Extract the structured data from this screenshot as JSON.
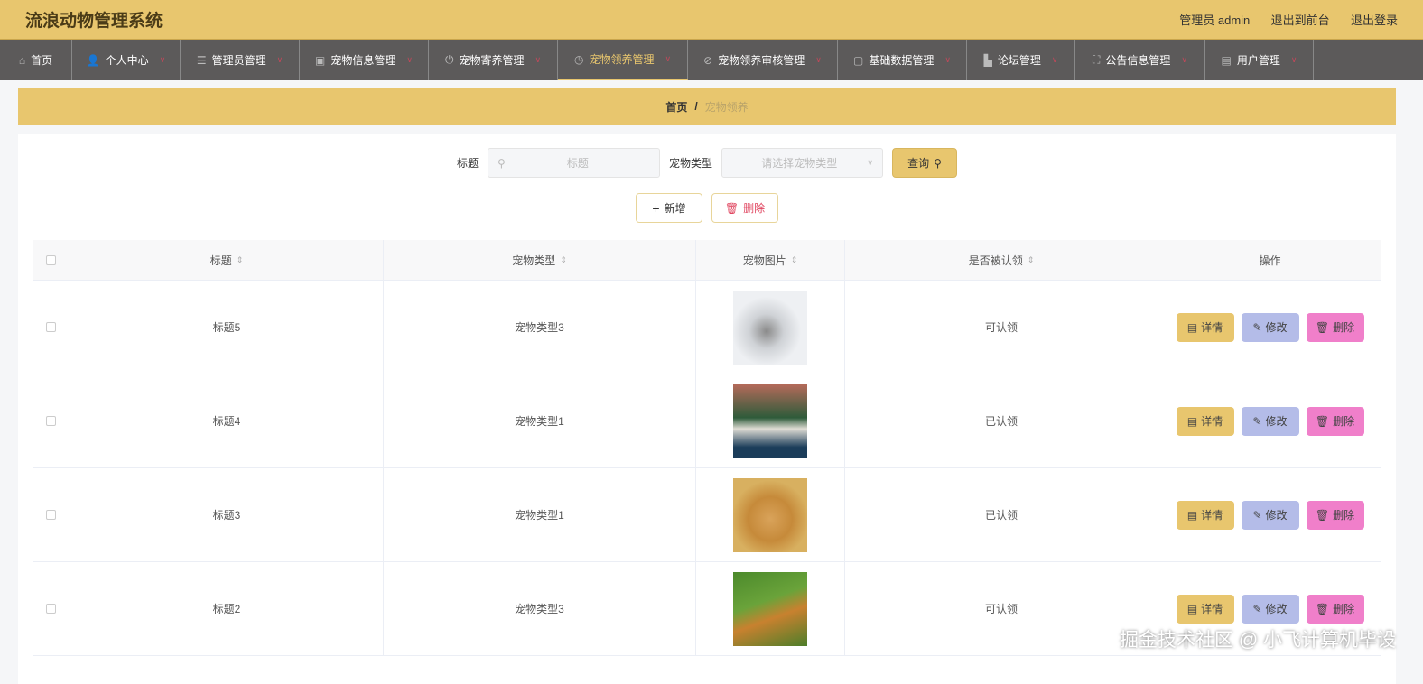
{
  "header": {
    "title": "流浪动物管理系统",
    "user": "管理员 admin",
    "front": "退出到前台",
    "logout": "退出登录"
  },
  "nav": [
    {
      "label": "首页",
      "icon": "home-icon"
    },
    {
      "label": "个人中心",
      "icon": "user-icon"
    },
    {
      "label": "管理员管理",
      "icon": "sliders-icon"
    },
    {
      "label": "宠物信息管理",
      "icon": "clipboard-icon"
    },
    {
      "label": "宠物寄养管理",
      "icon": "power-icon"
    },
    {
      "label": "宠物领养管理",
      "icon": "clock-icon",
      "active": true
    },
    {
      "label": "宠物领养审核管理",
      "icon": "no-icon"
    },
    {
      "label": "基础数据管理",
      "icon": "message-icon"
    },
    {
      "label": "论坛管理",
      "icon": "forum-icon"
    },
    {
      "label": "公告信息管理",
      "icon": "fullscreen-icon"
    },
    {
      "label": "用户管理",
      "icon": "document-icon"
    }
  ],
  "breadcrumb": {
    "home": "首页",
    "sep": "/",
    "current": "宠物领养"
  },
  "search": {
    "title_label": "标题",
    "title_placeholder": "标题",
    "type_label": "宠物类型",
    "type_placeholder": "请选择宠物类型",
    "query": "查询"
  },
  "actions": {
    "add": "新增",
    "delete": "删除"
  },
  "table": {
    "headers": [
      "标题",
      "宠物类型",
      "宠物图片",
      "是否被认领",
      "操作"
    ],
    "rows": [
      {
        "title": "标题5",
        "type": "宠物类型3",
        "status": "可认领"
      },
      {
        "title": "标题4",
        "type": "宠物类型1",
        "status": "已认领"
      },
      {
        "title": "标题3",
        "type": "宠物类型1",
        "status": "已认领"
      },
      {
        "title": "标题2",
        "type": "宠物类型3",
        "status": "可认领"
      }
    ],
    "ops": {
      "detail": "详情",
      "edit": "修改",
      "delete": "删除"
    }
  },
  "watermark": "掘金技术社区 @ 小飞计算机毕设",
  "colors": {
    "accent": "#e8c66e",
    "nav": "#5c5a5a",
    "edit": "#b4bce8",
    "danger": "#f07fca"
  }
}
